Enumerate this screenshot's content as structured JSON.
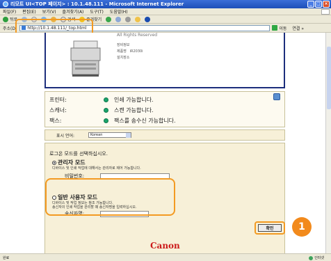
{
  "window": {
    "title": "리모트 UI<TOP 페이지> : 10.1.48.111 - Microsoft Internet Explorer",
    "buttons": [
      "_",
      "□",
      "×"
    ]
  },
  "menubar": {
    "items": [
      "파일(F)",
      "편집(E)",
      "보기(V)",
      "즐겨찾기(A)",
      "도구(T)",
      "도움말(H)"
    ]
  },
  "toolbar": {
    "back_label": "뒤로",
    "search_label": "검색",
    "favorites_label": "즐겨찾기"
  },
  "address": {
    "label": "주소(D)",
    "url": "http://10.1.48.111/_top.html",
    "go_label": "이동",
    "links_label": "연결 »"
  },
  "device": {
    "copyright": "All Rights Reserved",
    "info_label1": "장비정보",
    "info_label2": "제품명",
    "model": "iR2030i",
    "info_label3": "설치장소"
  },
  "status": {
    "rows": [
      {
        "label": "프린터:",
        "text": "인쇄 가능합니다."
      },
      {
        "label": "스캐너:",
        "text": "스캔 가능합니다."
      },
      {
        "label": "팩스:",
        "text": "팩스를 송수신 가능합니다."
      }
    ]
  },
  "language": {
    "label": "표시 언어:",
    "selected": "Korean"
  },
  "login": {
    "prompt": "로그온 모드를 선택하십시오.",
    "admin_title": "관리자 모드",
    "admin_desc": "디바이스 및 인쇄 작업에 대해서는 관리자로 제어 가능합니다.",
    "password_label": "비밀번호:",
    "user_title": "일반 사용자 모드",
    "user_desc1": "디바이스 및 작업 정보는 참조 가능합니다.",
    "user_desc2": "송신자의 인쇄 작업을 관리할 때 송신자명을 입력하십시오.",
    "sender_label": "송신자명:",
    "ok_label": "확인"
  },
  "step_number": "1",
  "brand": "Canon",
  "statusbar": {
    "left": "완료",
    "zone": "인터넷"
  }
}
